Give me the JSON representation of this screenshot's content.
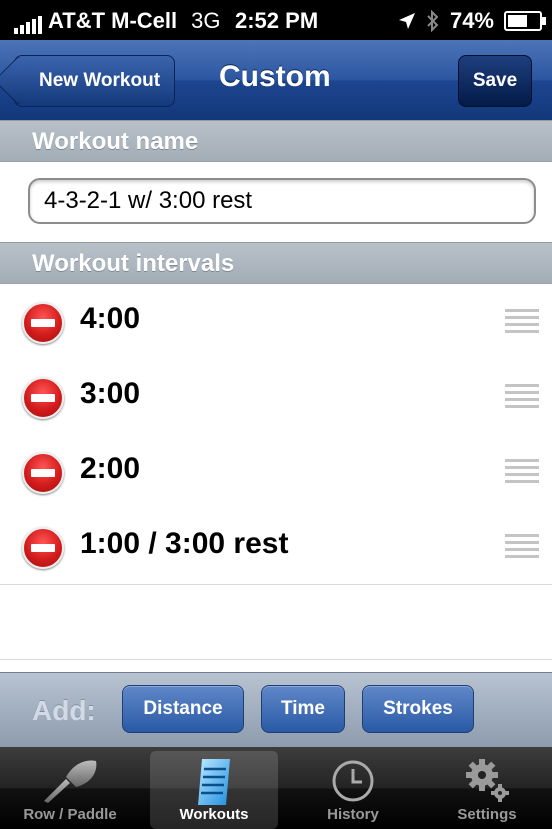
{
  "status_bar": {
    "carrier": "AT&T M-Cell",
    "network": "3G",
    "time": "2:52 PM",
    "battery": "74%",
    "battery_level": 0.74,
    "icons": [
      "signal-bars-icon",
      "location-arrow-icon",
      "bluetooth-icon",
      "battery-icon"
    ]
  },
  "nav": {
    "back_label": "New Workout",
    "title": "Custom",
    "save_label": "Save"
  },
  "workout_name": {
    "header": "Workout name",
    "value": "4-3-2-1 w/ 3:00 rest"
  },
  "intervals": {
    "header": "Workout intervals",
    "items": [
      {
        "label": "4:00"
      },
      {
        "label": "3:00"
      },
      {
        "label": "2:00"
      },
      {
        "label": "1:00 / 3:00 rest"
      }
    ]
  },
  "add_bar": {
    "label": "Add:",
    "buttons": [
      {
        "label": "Distance"
      },
      {
        "label": "Time"
      },
      {
        "label": "Strokes"
      }
    ]
  },
  "tab_bar": {
    "selected": "Workouts",
    "tabs": [
      {
        "label": "Row / Paddle",
        "icon": "paddle-icon"
      },
      {
        "label": "Workouts",
        "icon": "notepad-icon"
      },
      {
        "label": "History",
        "icon": "clock-icon"
      },
      {
        "label": "Settings",
        "icon": "gears-icon"
      }
    ]
  },
  "colors": {
    "nav_blue": "#2b56a0",
    "delete_red": "#d41c1c",
    "add_button_blue": "#3f6db6",
    "section_header_gray": "#a9b3bc"
  }
}
